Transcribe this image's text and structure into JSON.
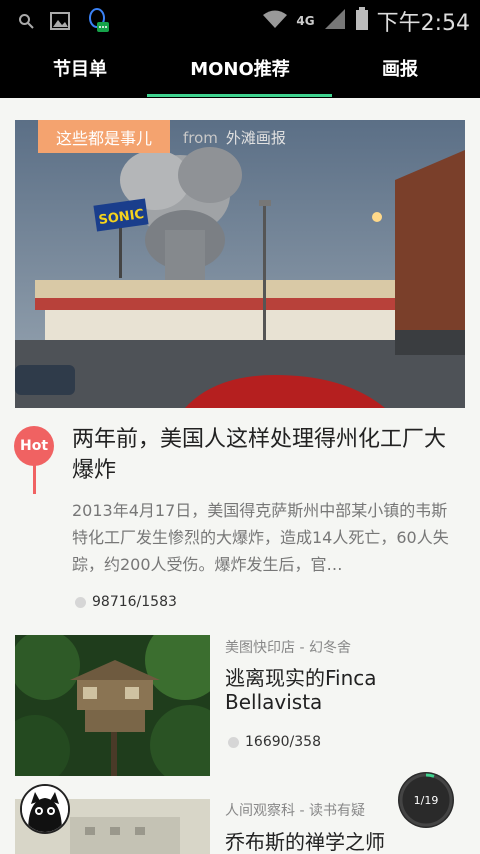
{
  "status_bar": {
    "network": "4G",
    "time": "下午2:54",
    "icons": [
      "search-icon",
      "image-icon",
      "qq-icon",
      "wifi-icon",
      "signal-icon",
      "battery-icon"
    ]
  },
  "tabs": [
    {
      "label": "节目单"
    },
    {
      "label": "MONO推荐",
      "active": true
    },
    {
      "label": "画报"
    }
  ],
  "colors": {
    "accent": "#3fd38f",
    "tag": "#f4a36f",
    "hot": "#f06262"
  },
  "feature": {
    "tag": "这些都是事儿",
    "from_word": "from",
    "source": "外滩画报",
    "hot_label": "Hot",
    "title": "两年前，美国人这样处理得州化工厂大爆炸",
    "description": "2013年4月17日，美国得克萨斯州中部某小镇的韦斯特化工厂发生惨烈的大爆炸，造成14人死亡，60人失踪，约200人受伤。爆炸发生后，官…",
    "stats": "98716/1583",
    "sign_text": "SONIC"
  },
  "items": [
    {
      "source": "美图快印店 - 幻冬舍",
      "title": "逃离现实的Finca Bellavista",
      "stats": "16690/358"
    },
    {
      "source": "人间观察科 - 读书有疑",
      "title": "乔布斯的禅学之师",
      "stats": ""
    }
  ],
  "pager": {
    "label": "1/19",
    "progress": 0.0526
  }
}
